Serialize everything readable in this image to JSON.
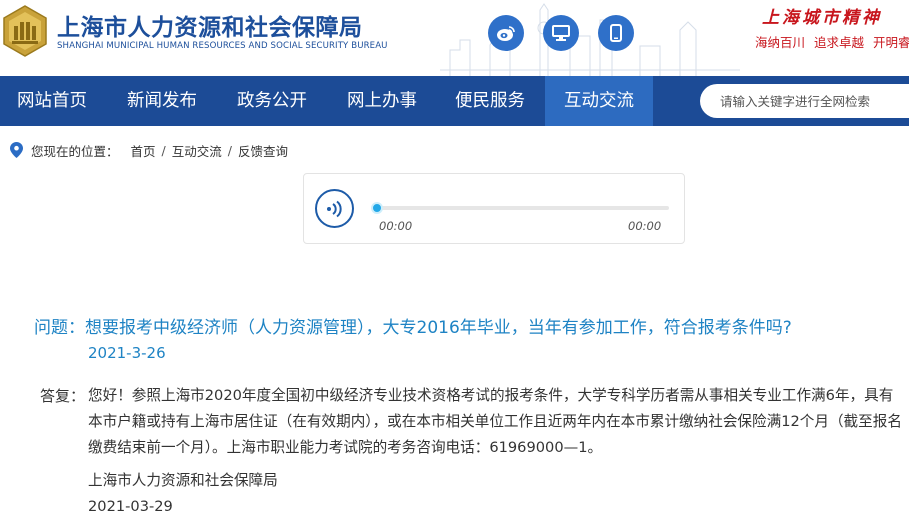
{
  "header": {
    "title": "上海市人力资源和社会保障局",
    "subtitle": "SHANGHAI MUNICIPAL HUMAN RESOURCES AND SOCIAL SECURITY BUREAU",
    "icons": [
      "weibo-icon",
      "desktop-icon",
      "mobile-icon"
    ],
    "spirit": "上海城市精神",
    "slogan": [
      "海纳百川",
      "追求卓越",
      "开明睿智"
    ]
  },
  "nav": {
    "items": [
      "网站首页",
      "新闻发布",
      "政务公开",
      "网上办事",
      "便民服务",
      "互动交流"
    ],
    "active": "互动交流",
    "search_placeholder": "请输入关键字进行全网检索"
  },
  "breadcrumb": {
    "label": "您现在的位置：",
    "items": [
      "首页",
      "互动交流",
      "反馈查询"
    ]
  },
  "player": {
    "current_time": "00:00",
    "total_time": "00:00",
    "progress": 0
  },
  "qa": {
    "question_label": "问题：",
    "question": "想要报考中级经济师（人力资源管理），大专2016年毕业，当年有参加工作，符合报考条件吗?",
    "question_date": "2021-3-26",
    "answer_label": "答复：",
    "answer": "您好！参照上海市2020年度全国初中级经济专业技术资格考试的报考条件，大学专科学历者需从事相关专业工作满6年，具有本市户籍或持有上海市居住证（在有效期内），或在本市相关单位工作且近两年内在本市累计缴纳社会保险满12个月（截至报名缴费结束前一个月）。上海市职业能力考试院的考务咨询电话：61969000—1。",
    "answer_org": "上海市人力资源和社会保障局",
    "answer_date": "2021-03-29"
  },
  "colors": {
    "brand_blue": "#1c4b96",
    "active_nav": "#2d6bc0",
    "question_blue": "#1e83c4",
    "slogan_red": "#c8161d"
  }
}
